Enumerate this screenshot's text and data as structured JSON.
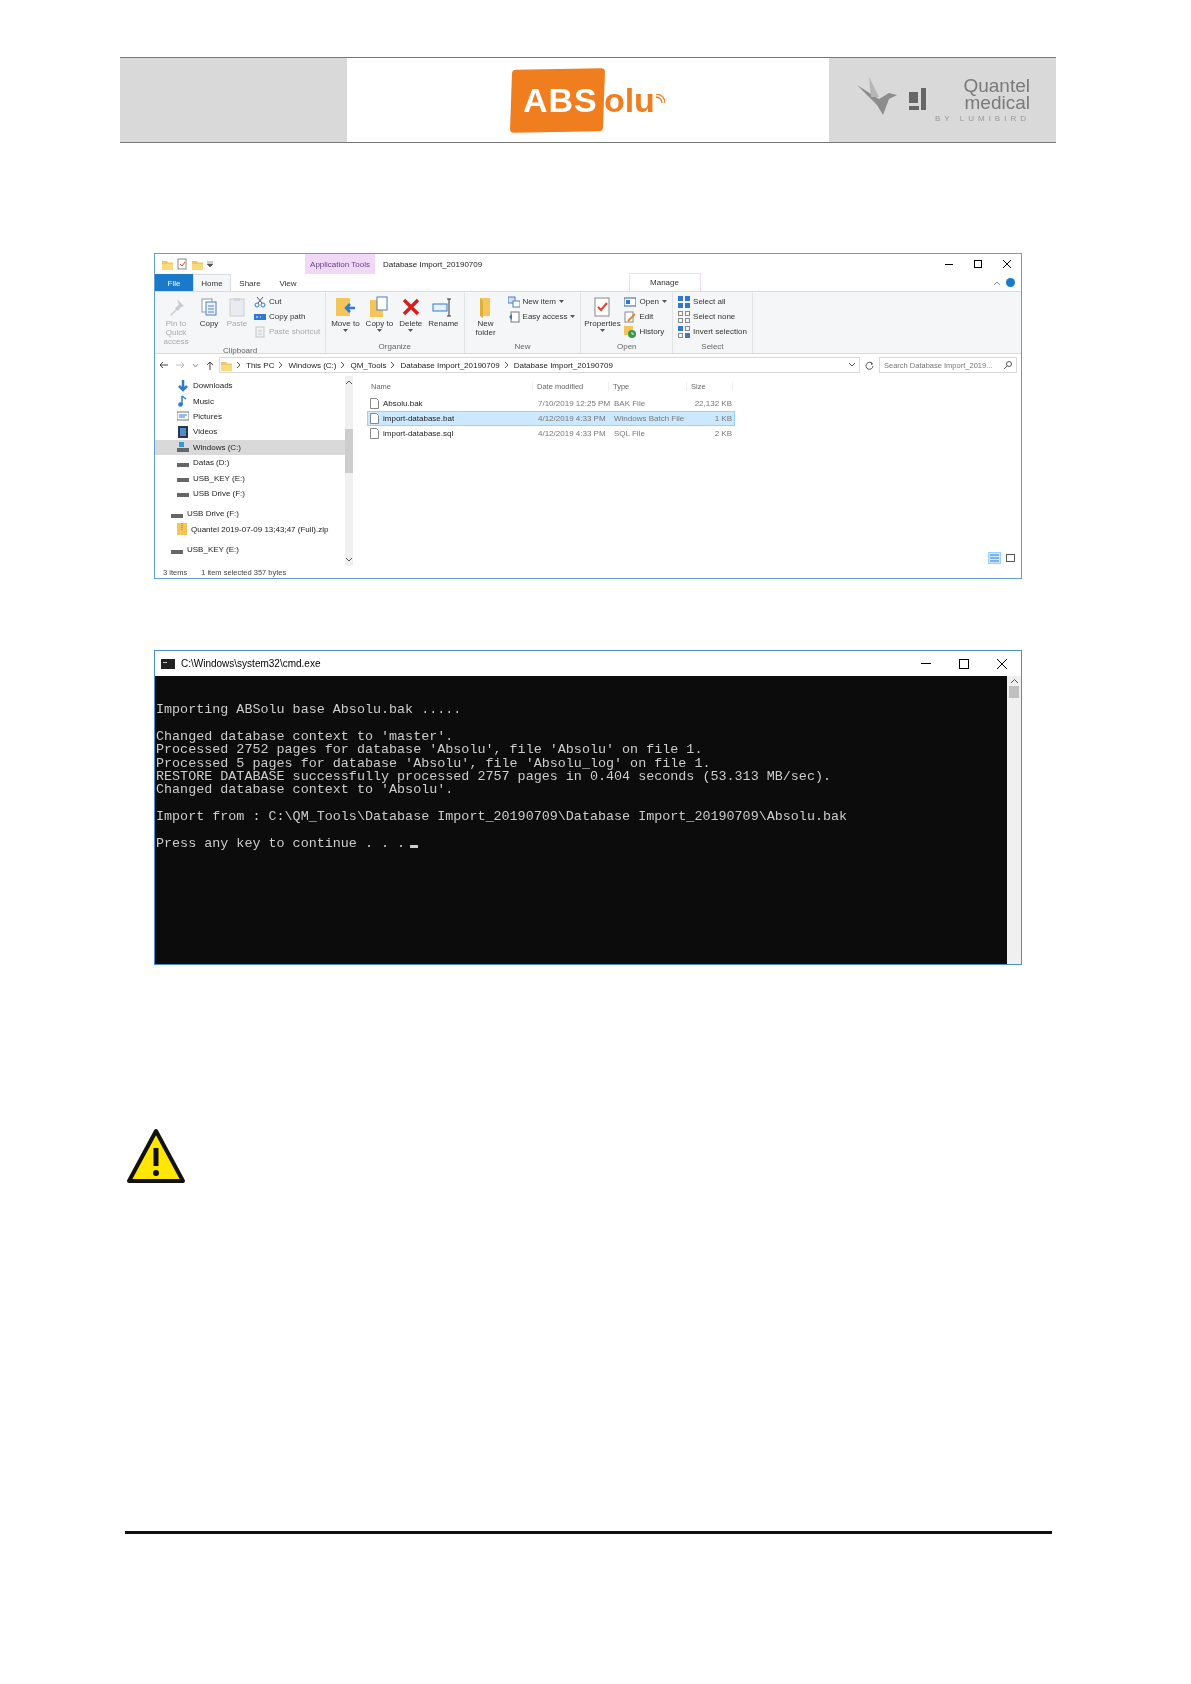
{
  "header": {
    "logo": {
      "mark": "ABS",
      "rest": "olu"
    },
    "partner": {
      "line1": "Quantel",
      "line2": "medical",
      "tagline": "BY LUMIBIRD"
    }
  },
  "explorer": {
    "title": "Database Import_20190709",
    "context_tab": "Application Tools",
    "tabs": [
      {
        "label": "File",
        "selected": false
      },
      {
        "label": "Home",
        "selected": true
      },
      {
        "label": "Share",
        "selected": false
      },
      {
        "label": "View",
        "selected": false
      },
      {
        "label": "Manage",
        "selected": false
      }
    ],
    "ribbon": [
      {
        "label": "Clipboard",
        "large": [
          {
            "label": "Pin to Quick access",
            "disabled": true,
            "menu": false
          },
          {
            "label": "Copy",
            "disabled": false,
            "menu": false
          },
          {
            "label": "Paste",
            "disabled": true,
            "menu": false
          }
        ],
        "small": [
          {
            "label": "Cut",
            "disabled": false,
            "menu": false
          },
          {
            "label": "Copy path",
            "disabled": false,
            "menu": false
          },
          {
            "label": "Paste shortcut",
            "disabled": true,
            "menu": false
          }
        ]
      },
      {
        "label": "Organize",
        "large": [
          {
            "label": "Move to",
            "disabled": false,
            "menu": true
          },
          {
            "label": "Copy to",
            "disabled": false,
            "menu": true
          },
          {
            "label": "Delete",
            "disabled": false,
            "menu": true
          },
          {
            "label": "Rename",
            "disabled": false,
            "menu": false
          }
        ]
      },
      {
        "label": "New",
        "large": [
          {
            "label": "New folder",
            "disabled": false,
            "menu": false
          }
        ],
        "small": [
          {
            "label": "New item",
            "disabled": false,
            "menu": true
          },
          {
            "label": "Easy access",
            "disabled": false,
            "menu": true
          }
        ]
      },
      {
        "label": "Open",
        "large": [
          {
            "label": "Properties",
            "disabled": false,
            "menu": true
          }
        ],
        "small": [
          {
            "label": "Open",
            "disabled": false,
            "menu": true
          },
          {
            "label": "Edit",
            "disabled": false,
            "menu": false
          },
          {
            "label": "History",
            "disabled": false,
            "menu": false
          }
        ]
      },
      {
        "label": "Select",
        "small": [
          {
            "label": "Select all",
            "disabled": false,
            "menu": false
          },
          {
            "label": "Select none",
            "disabled": false,
            "menu": false
          },
          {
            "label": "Invert selection",
            "disabled": false,
            "menu": false
          }
        ]
      }
    ],
    "breadcrumb": [
      "This PC",
      "Windows (C:)",
      "QM_Tools",
      "Database Import_20190709",
      "Database Import_20190709"
    ],
    "search": {
      "placeholder": "Search Database Import_2019..."
    },
    "nav_tree": {
      "items": [
        {
          "label": "Downloads",
          "selected": false
        },
        {
          "label": "Music",
          "selected": false
        },
        {
          "label": "Pictures",
          "selected": false
        },
        {
          "label": "Videos",
          "selected": false
        },
        {
          "label": "Windows (C:)",
          "selected": true
        },
        {
          "label": "Datas (D:)",
          "selected": false
        },
        {
          "label": "USB_KEY (E:)",
          "selected": false
        },
        {
          "label": "USB Drive (F:)",
          "selected": false
        }
      ],
      "drives": [
        {
          "label": "USB Drive (F:)",
          "selected": false,
          "children": [
            {
              "label": "Quantel 2019-07-09 13;43;47 (Full).zip",
              "selected": false
            }
          ]
        },
        {
          "label": "USB_KEY (E:)",
          "selected": false
        }
      ]
    },
    "columns": [
      "Name",
      "Date modified",
      "Type",
      "Size"
    ],
    "files": [
      {
        "name": "Absolu.bak",
        "modified": "7/10/2019 12:25 PM",
        "type": "BAK File",
        "size": "22,132 KB",
        "selected": false
      },
      {
        "name": "import-database.bat",
        "modified": "4/12/2019 4:33 PM",
        "type": "Windows Batch File",
        "size": "1 KB",
        "selected": true
      },
      {
        "name": "import-database.sql",
        "modified": "4/12/2019 4:33 PM",
        "type": "SQL File",
        "size": "2 KB",
        "selected": false
      }
    ],
    "status": {
      "count": "3 items",
      "selection": "1 item selected  357 bytes"
    }
  },
  "console": {
    "title": "C:\\Windows\\system32\\cmd.exe",
    "paragraphs": [
      [
        "Importing ABSolu base Absolu.bak ....."
      ],
      [
        "Changed database context to 'master'.",
        "Processed 2752 pages for database 'Absolu', file 'Absolu' on file 1.",
        "Processed 5 pages for database 'Absolu', file 'Absolu_log' on file 1.",
        "RESTORE DATABASE successfully processed 2757 pages in 0.404 seconds (53.313 MB/sec).",
        "Changed database context to 'Absolu'."
      ],
      [
        "Import from : C:\\QM_Tools\\Database Import_20190709\\Database Import_20190709\\Absolu.bak"
      ],
      [
        "Press any key to continue . . ."
      ]
    ]
  }
}
